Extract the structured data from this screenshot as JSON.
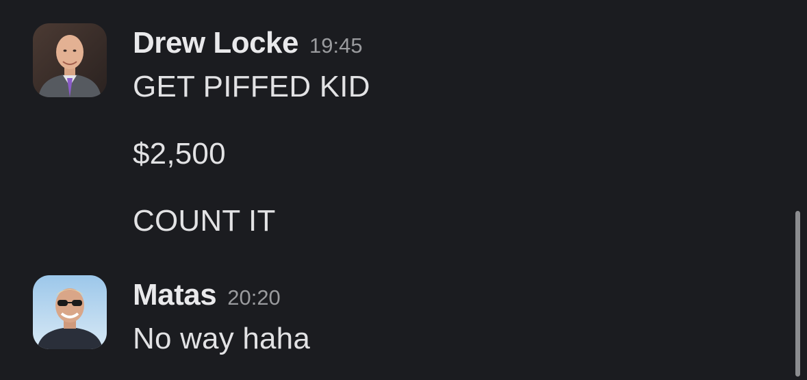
{
  "messages": [
    {
      "sender": "Drew Locke",
      "time": "19:45",
      "lines": [
        "GET PIFFED KID",
        "$2,500",
        "COUNT IT"
      ]
    },
    {
      "sender": "Matas",
      "time": "20:20",
      "lines": [
        "No way haha"
      ]
    }
  ],
  "colors": {
    "background": "#1b1c20",
    "sender_text": "#e9e9eb",
    "timestamp_text": "#9a9b9e",
    "body_text": "#e2e2e4"
  }
}
